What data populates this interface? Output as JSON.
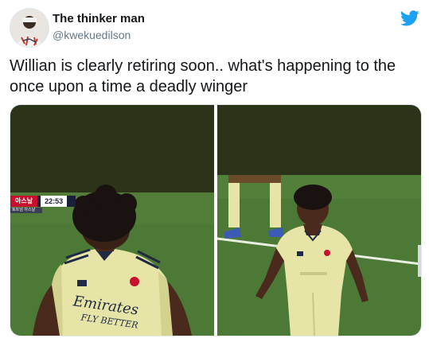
{
  "author": {
    "display_name": "The thinker man",
    "handle": "@kwekuedilson"
  },
  "tweet": {
    "text": "Willian is clearly retiring soon.. what's happening to the once upon a time a deadly winger"
  },
  "media": {
    "left_photo": {
      "scorebug_team": "아스날",
      "scorebug_time": "22:53",
      "scorebug_sub": "토트넘 아스날",
      "shirt_sponsor_line1": "Emirates",
      "shirt_sponsor_line2": "FLY BETTER"
    }
  },
  "colors": {
    "twitter_blue": "#1da1f2",
    "shirt_yellow": "#e6e4a6",
    "pitch_green": "#4c7a36",
    "stand_dark": "#2b3318"
  },
  "icons": {
    "brand": "twitter-bird-icon"
  }
}
